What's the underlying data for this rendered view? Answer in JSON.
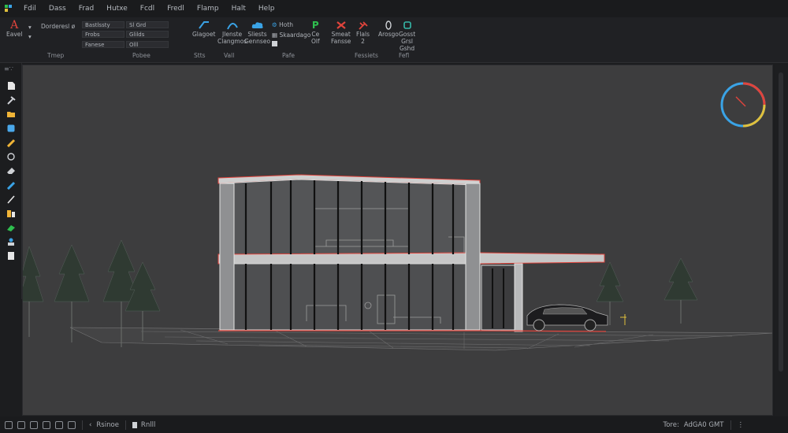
{
  "menubar": {
    "items": [
      "Fdil",
      "Dass",
      "Frad",
      "Hutxe",
      "Fcdl",
      "Fredl",
      "Flamp",
      "Halt",
      "Help"
    ]
  },
  "ribbon": {
    "tools": [
      {
        "label": "Eavel",
        "icon": "text-a-icon",
        "color": "#e0443c"
      },
      {
        "label": "Glagoet",
        "icon": "line-tool-icon",
        "color": "#3aa3e6"
      },
      {
        "label": "Jlenste",
        "icon": "curve-tool-icon",
        "color": "#3aa3e6"
      },
      {
        "label": "Sliests",
        "icon": "cloud-icon",
        "color": "#3aa3e6"
      },
      {
        "label": "Ce",
        "icon": "cursor-icon",
        "color": "#2fbf4f"
      },
      {
        "label": "Smeat",
        "icon": "warning-icon",
        "color": "#e0443c"
      },
      {
        "label": "Flals",
        "icon": "wrench-icon",
        "color": "#e0443c"
      },
      {
        "label": "Arosgo",
        "icon": "ring-icon",
        "color": "#cfd2d6"
      },
      {
        "label": "Gosst",
        "icon": "cube-icon",
        "color": "#35b8a8"
      }
    ],
    "text_lines": {
      "l1": "Dorderesl ø",
      "l2": "Bastlssty",
      "l3": "Frobs",
      "l4": "Fanese",
      "l5": "Sl Grd",
      "l6": "Glilds",
      "l7": "Olll",
      "l8": "Clangmos",
      "l9": "Gennseo",
      "l10": "Hoth",
      "l11": "Skaardago",
      "l12": "Olf",
      "l13": "Fansse",
      "l14": "2",
      "l15": "Grsl",
      "l16": "Gshd"
    },
    "groups": [
      "Tmep",
      "Pobee",
      "Stts",
      "Vall",
      "Pafe",
      "Fessiets",
      "Fefl"
    ]
  },
  "left_toolbar": {
    "header": "≡∵",
    "tools": [
      "document-icon",
      "hammer-icon",
      "folder-icon",
      "cube-icon",
      "pencil-icon",
      "rotate-icon",
      "eraser-icon",
      "pen-icon",
      "brush-icon",
      "layers-icon",
      "gem-icon",
      "user-icon",
      "print-icon"
    ]
  },
  "statusbar": {
    "tabs": [
      "Rsinoe",
      "Rnlll"
    ],
    "right_label": "Tore:",
    "right_value": "AdGA0 GMT"
  },
  "colors": {
    "accent_red": "#e0443c",
    "accent_blue": "#3aa3e6",
    "accent_green": "#2fbf4f",
    "accent_teal": "#35b8a8"
  }
}
